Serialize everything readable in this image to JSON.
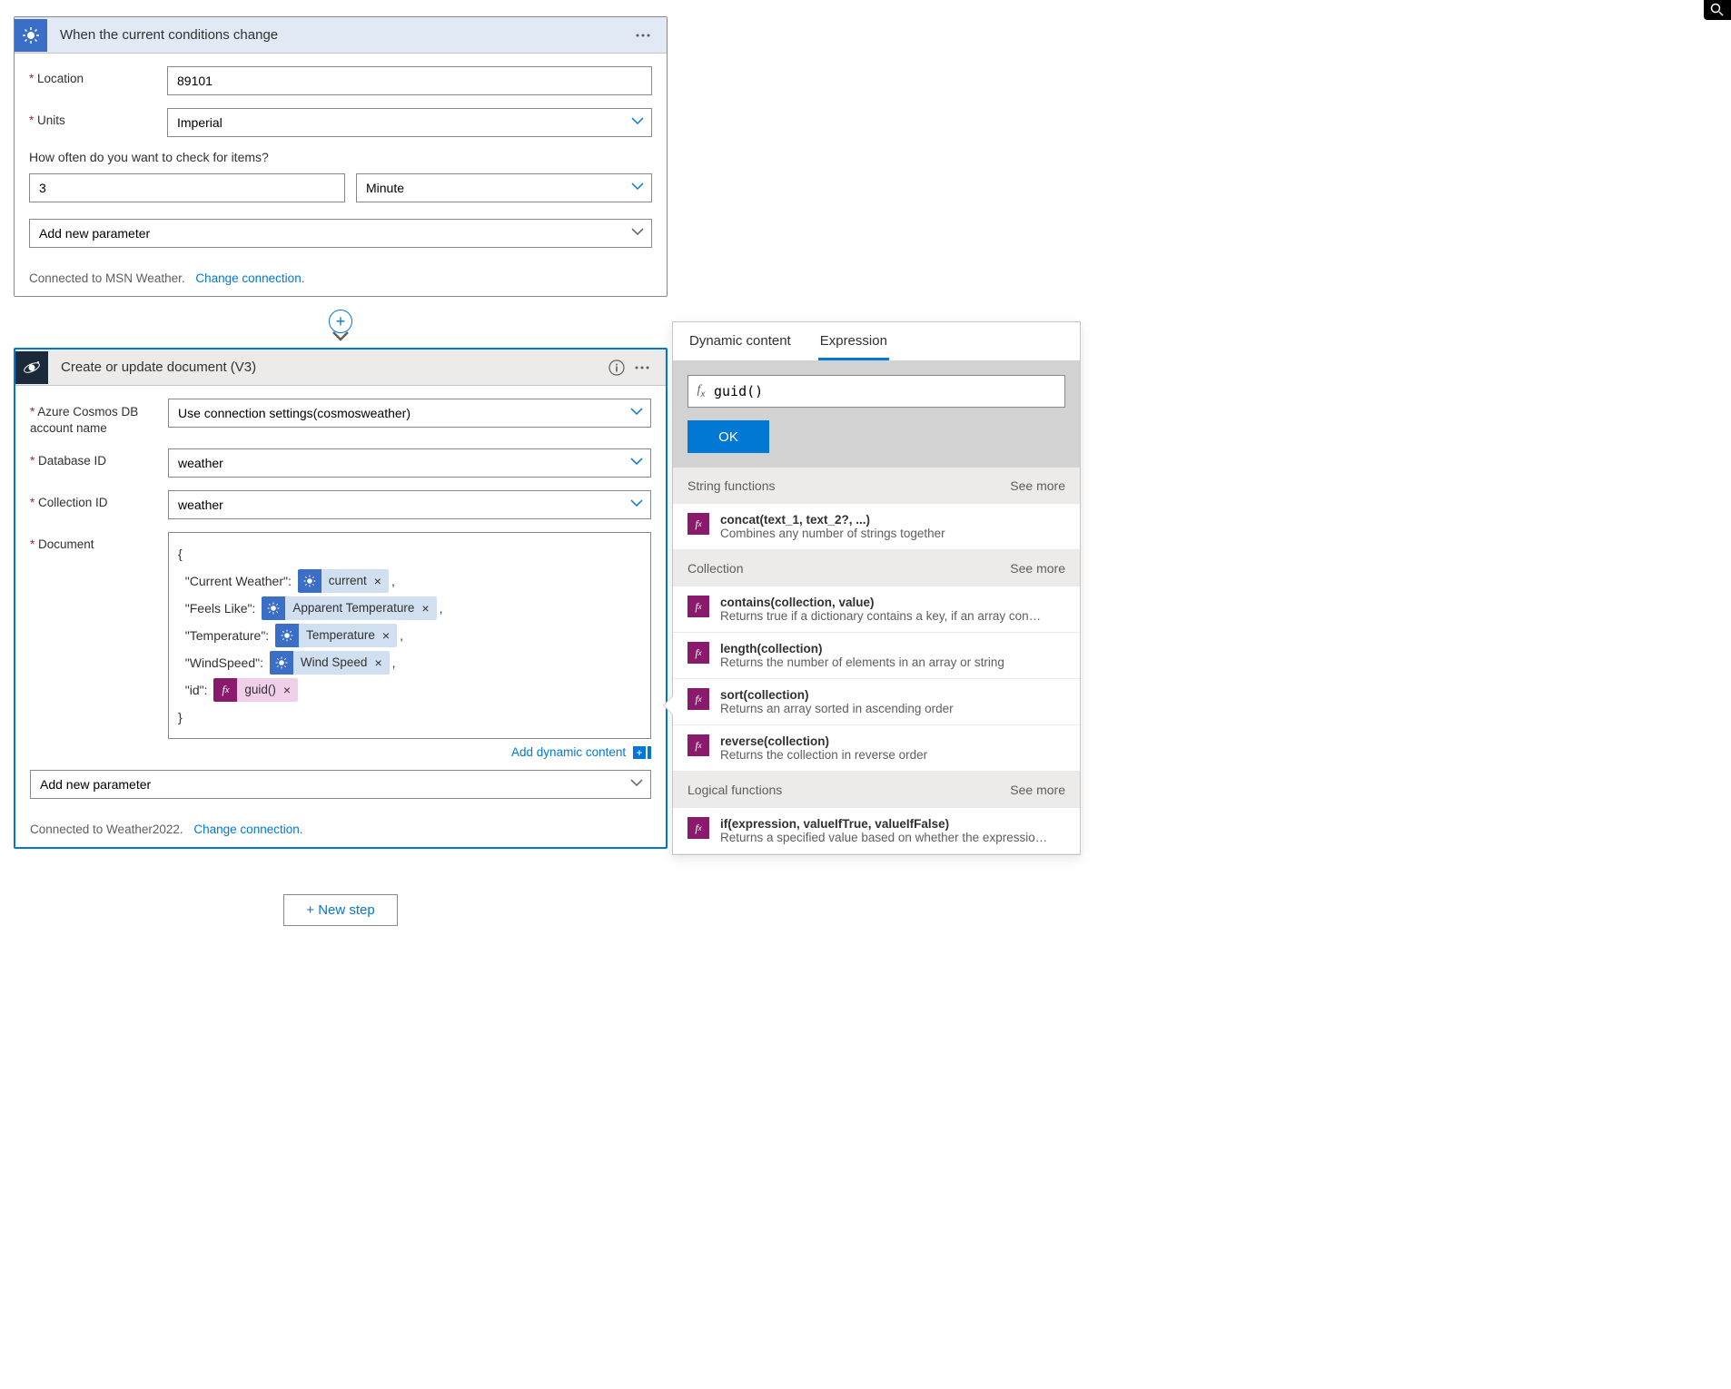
{
  "trigger": {
    "title": "When the current conditions change",
    "location_label": "Location",
    "location_value": "89101",
    "units_label": "Units",
    "units_value": "Imperial",
    "poll_question": "How often do you want to check for items?",
    "poll_interval": "3",
    "poll_unit": "Minute",
    "add_param": "Add new parameter",
    "conn_text": "Connected to MSN Weather.",
    "change_conn": "Change connection."
  },
  "action": {
    "title": "Create or update document (V3)",
    "account_label": "Azure Cosmos DB account name",
    "account_value": "Use connection settings(cosmosweather)",
    "db_label": "Database ID",
    "db_value": "weather",
    "coll_label": "Collection ID",
    "coll_value": "weather",
    "doc_label": "Document",
    "doc_open": "{",
    "doc_lines": [
      {
        "prefix": "  \"Current Weather\": ",
        "token_type": "weather",
        "token_label": "current",
        "suffix": ","
      },
      {
        "prefix": "  \"Feels Like\": ",
        "token_type": "weather",
        "token_label": "Apparent Temperature",
        "suffix": ","
      },
      {
        "prefix": "  \"Temperature\": ",
        "token_type": "weather",
        "token_label": "Temperature",
        "suffix": ","
      },
      {
        "prefix": "  \"WindSpeed\": ",
        "token_type": "weather",
        "token_label": "Wind Speed",
        "suffix": ","
      },
      {
        "prefix": "  \"id\": ",
        "token_type": "fx",
        "token_label": "guid()",
        "suffix": ""
      }
    ],
    "doc_close": "}",
    "add_dyn": "Add dynamic content",
    "add_param": "Add new parameter",
    "conn_text": "Connected to Weather2022.",
    "change_conn": "Change connection."
  },
  "new_step": "+ New step",
  "panel": {
    "tab_dynamic": "Dynamic content",
    "tab_expression": "Expression",
    "expr_value": "guid()",
    "ok": "OK",
    "groups": [
      {
        "name": "String functions",
        "see": "See more",
        "items": [
          {
            "sig": "concat(text_1, text_2?, ...)",
            "desc": "Combines any number of strings together"
          }
        ]
      },
      {
        "name": "Collection",
        "see": "See more",
        "items": [
          {
            "sig": "contains(collection, value)",
            "desc": "Returns true if a dictionary contains a key, if an array con…"
          },
          {
            "sig": "length(collection)",
            "desc": "Returns the number of elements in an array or string"
          },
          {
            "sig": "sort(collection)",
            "desc": "Returns an array sorted in ascending order"
          },
          {
            "sig": "reverse(collection)",
            "desc": "Returns the collection in reverse order"
          }
        ]
      },
      {
        "name": "Logical functions",
        "see": "See more",
        "items": [
          {
            "sig": "if(expression, valueIfTrue, valueIfFalse)",
            "desc": "Returns a specified value based on whether the expressio…"
          }
        ]
      }
    ]
  }
}
